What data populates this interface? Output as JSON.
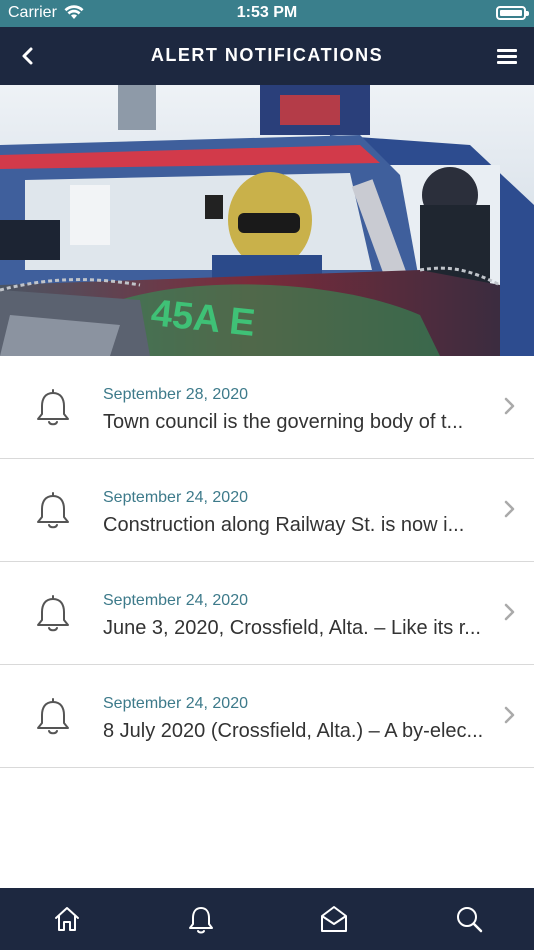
{
  "status_bar": {
    "carrier": "Carrier",
    "time": "1:53 PM"
  },
  "nav": {
    "title": "ALERT NOTIFICATIONS",
    "back_icon": "chevron-left-icon",
    "menu_icon": "hamburger-menu-icon"
  },
  "hero": {
    "car_text": "45A E"
  },
  "notifications": [
    {
      "date": "September 28, 2020",
      "text": "Town council is the governing body of t..."
    },
    {
      "date": "September 24, 2020",
      "text": "Construction along Railway St. is now i..."
    },
    {
      "date": "September 24, 2020",
      "text": "June 3, 2020, Crossfield, Alta. – Like its r..."
    },
    {
      "date": "September 24, 2020",
      "text": "8 July 2020 (Crossfield, Alta.) – A by-elec..."
    }
  ],
  "tab_bar": {
    "tabs": [
      "home-icon",
      "bell-icon",
      "envelope-open-icon",
      "search-icon"
    ]
  },
  "colors": {
    "status_bar": "#3a7f8c",
    "nav_bar": "#1d2840",
    "date_text": "#3d7a8a",
    "body_text": "#333333"
  }
}
